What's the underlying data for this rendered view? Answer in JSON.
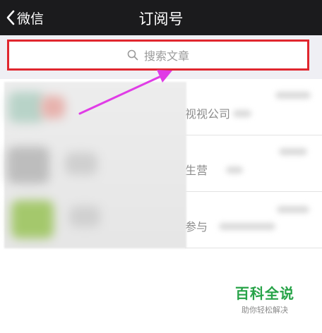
{
  "nav": {
    "back_label": "微信",
    "title": "订阅号"
  },
  "search": {
    "placeholder": "搜索文章"
  },
  "list": {
    "rows": [
      {
        "text": "视视公司"
      },
      {
        "text": "生营"
      },
      {
        "text": "参与"
      }
    ]
  },
  "watermark": {
    "title": "百科全说",
    "subtitle": "助你轻松解决"
  },
  "colors": {
    "navbar": "#1b1b1d",
    "highlight_border": "#e0262e",
    "arrow": "#e03ce6",
    "watermark_green": "#27a348"
  },
  "icons": [
    "chevron-left-icon",
    "search-icon"
  ]
}
